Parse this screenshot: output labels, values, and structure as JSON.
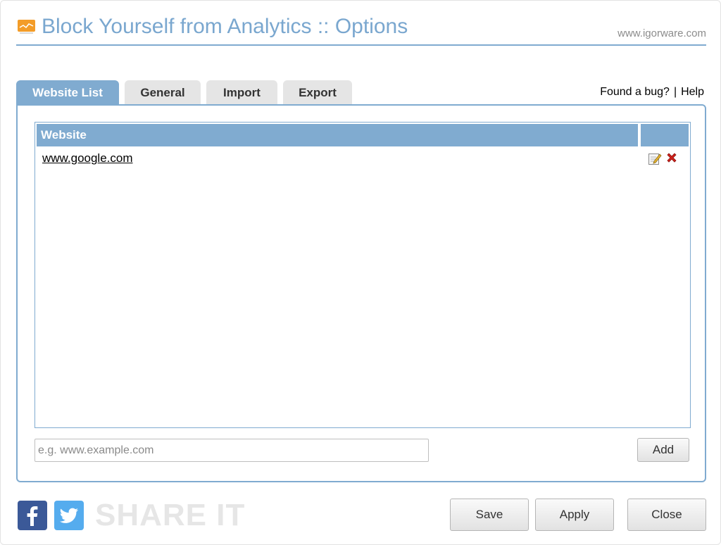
{
  "header": {
    "title": "Block Yourself from Analytics :: Options",
    "site": "www.igorware.com"
  },
  "tabs": [
    {
      "label": "Website List",
      "active": true
    },
    {
      "label": "General",
      "active": false
    },
    {
      "label": "Import",
      "active": false
    },
    {
      "label": "Export",
      "active": false
    }
  ],
  "links": {
    "bug": "Found a bug?",
    "separator": "|",
    "help": "Help"
  },
  "list": {
    "column_header": "Website",
    "rows": [
      {
        "website": "www.google.com",
        "actions": [
          "edit-icon",
          "delete-icon"
        ]
      }
    ]
  },
  "add_form": {
    "input_value": "",
    "input_placeholder": "e.g. www.example.com",
    "add_label": "Add"
  },
  "footer": {
    "share_label": "SHARE IT",
    "icons": [
      "facebook-icon",
      "twitter-icon"
    ],
    "save_label": "Save",
    "apply_label": "Apply",
    "close_label": "Close"
  },
  "colors": {
    "accent": "#80abd0",
    "title": "#7aa7cf",
    "tab_inactive": "#e5e5e5",
    "delete": "#d0201a",
    "logo": "#f39c28",
    "facebook": "#3b5998",
    "twitter": "#55acee"
  }
}
